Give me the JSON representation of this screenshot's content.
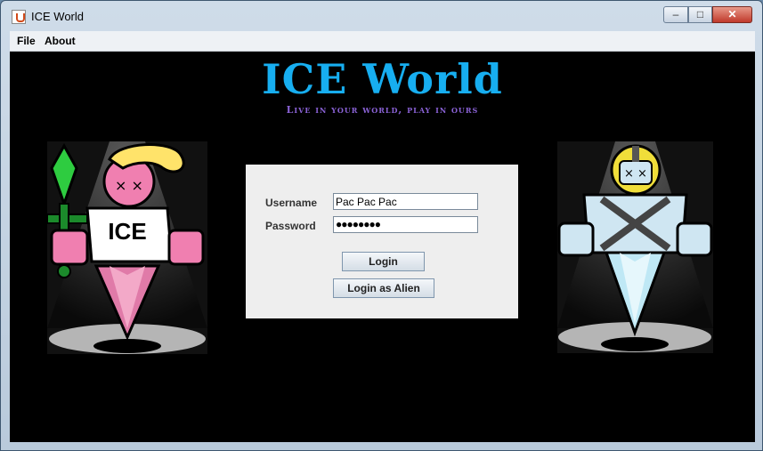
{
  "window": {
    "title": "ICE World",
    "minimize": "–",
    "maximize": "□",
    "close": "✕"
  },
  "menu": {
    "items": [
      "File",
      "About"
    ]
  },
  "header": {
    "logo": "ICE World",
    "tagline": "Live in your world, play in ours"
  },
  "left_character": {
    "shirt_text": "ICE",
    "icon": "ice-character-illustration"
  },
  "right_character": {
    "icon": "alien-knight-illustration"
  },
  "login": {
    "username_label": "Username",
    "username_value": "Pac Pac Pac",
    "password_label": "Password",
    "password_value": "●●●●●●●●",
    "login_button": "Login",
    "alien_button": "Login as Alien"
  },
  "colors": {
    "logo": "#17aef0",
    "tagline": "#8a62d6",
    "background": "#000000",
    "panel": "#eeeeee"
  }
}
